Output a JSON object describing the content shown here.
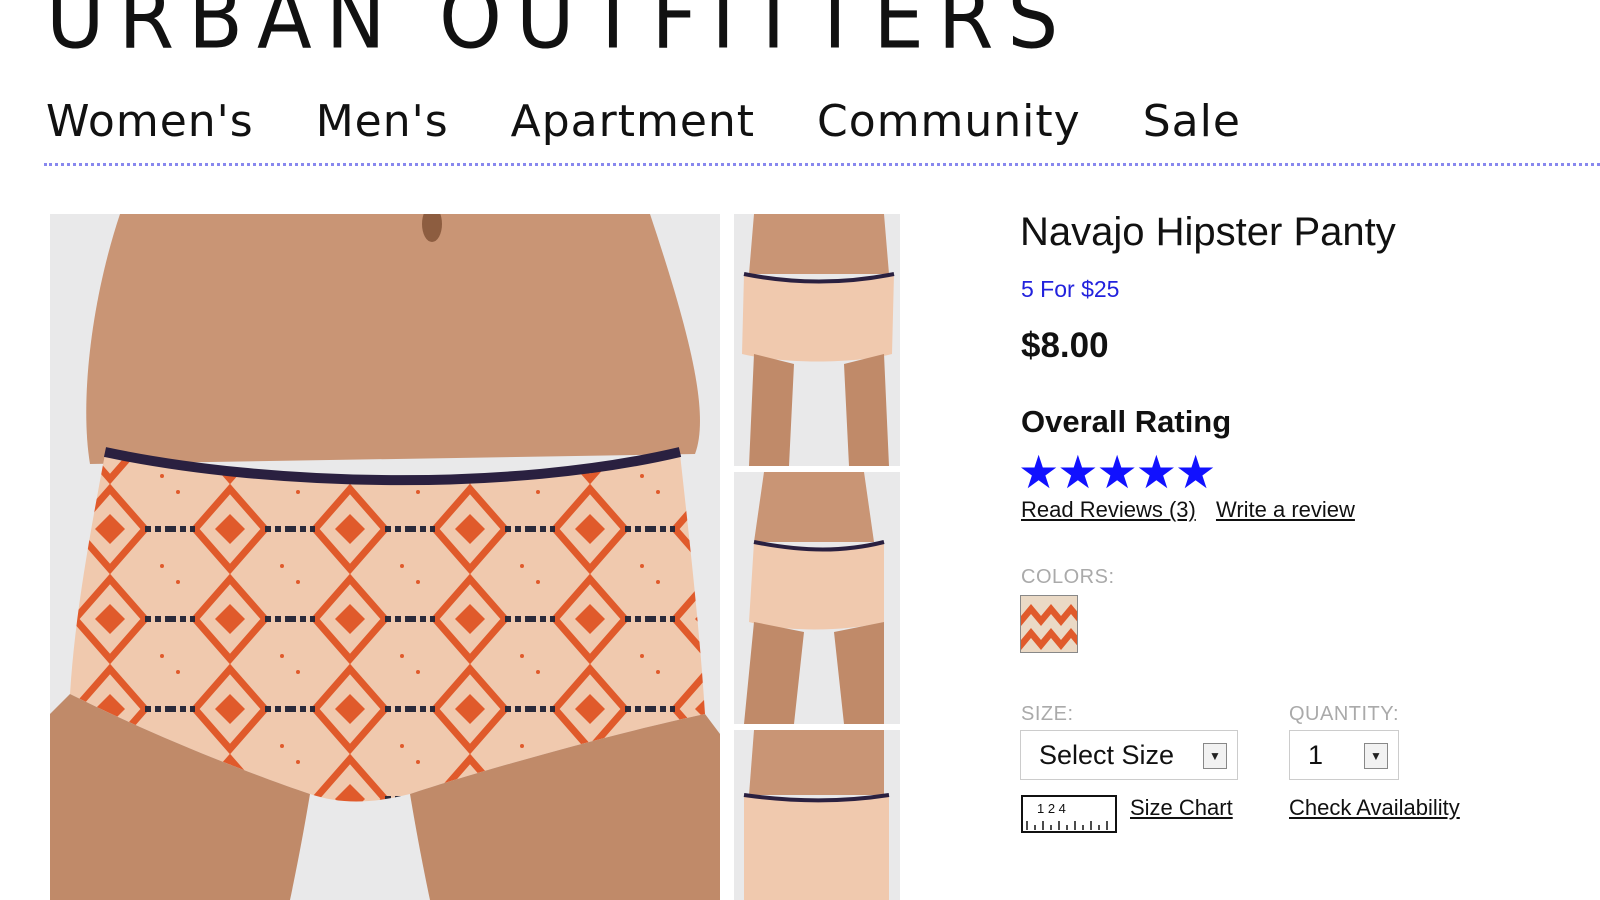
{
  "brand": {
    "logo_text": "URBAN OUTFITTERS"
  },
  "nav": {
    "items": [
      "Women's",
      "Men's",
      "Apartment",
      "Community",
      "Sale"
    ]
  },
  "product": {
    "title": "Navajo Hipster Panty",
    "promo": "5 For $25",
    "price": "$8.00",
    "rating_label": "Overall Rating",
    "rating_value": 5,
    "rating_max": 5,
    "stars_glyph": "★★★★★",
    "read_reviews": "Read Reviews (3)",
    "write_review": "Write a review",
    "colors_label": "COLORS:",
    "size_label": "SIZE:",
    "size_select": "Select Size",
    "quantity_label": "QUANTITY:",
    "quantity_value": "1",
    "size_chart": "Size Chart",
    "check_availability": "Check Availability",
    "ruler_marks": "1 2 4"
  },
  "colors": {
    "link": "#2222dd",
    "stars": "#1111ff",
    "divider": "#8888ee",
    "pattern_orange": "#e05a2b"
  },
  "icons": {
    "dropdown": "chevron-down-icon",
    "ruler": "ruler-icon"
  }
}
